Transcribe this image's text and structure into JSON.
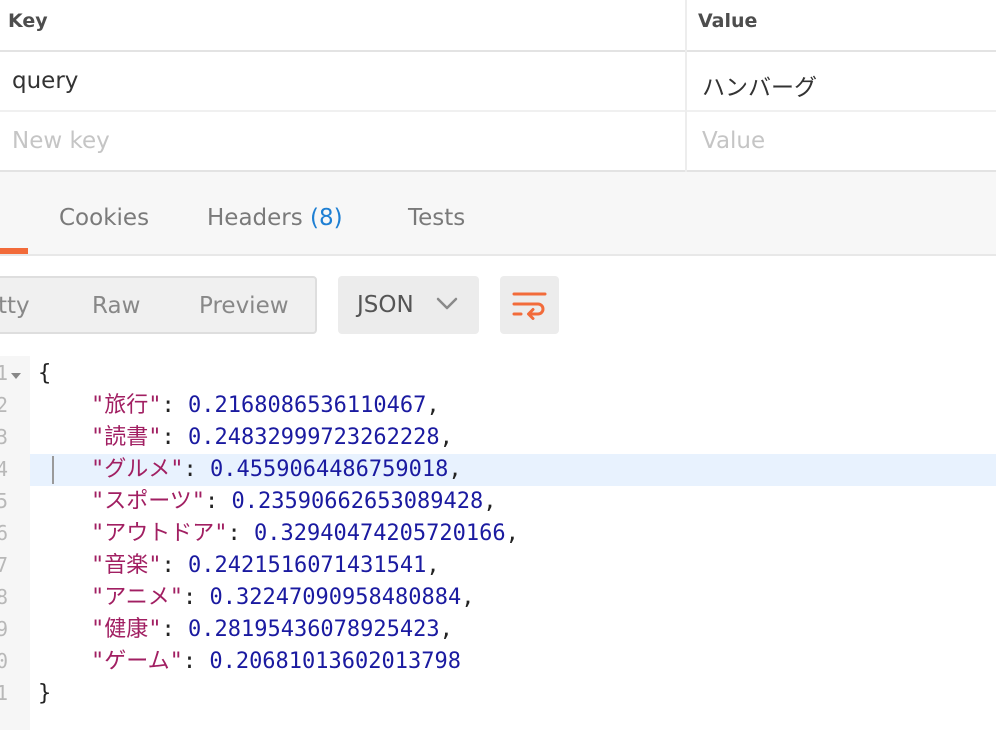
{
  "params": {
    "header": {
      "key": "Key",
      "value": "Value"
    },
    "rows": [
      {
        "key": "query",
        "value": "ハンバーグ"
      }
    ],
    "new_row": {
      "key_placeholder": "New key",
      "value_placeholder": "Value"
    }
  },
  "response_tabs": {
    "tabs": [
      {
        "label": "Cookies"
      },
      {
        "label": "Headers",
        "count": "(8)"
      },
      {
        "label": "Tests"
      }
    ]
  },
  "toolbar": {
    "view_modes": [
      "tty",
      "Raw",
      "Preview"
    ],
    "format": "JSON"
  },
  "colors": {
    "accent": "#f26b3a",
    "link_blue": "#1e7fd3",
    "json_key": "#a11f62",
    "json_number": "#1a1aa0",
    "highlight_line": "#e8f2fe"
  },
  "code": {
    "line_numbers": [
      "1",
      "2",
      "3",
      "4",
      "5",
      "6",
      "7",
      "8",
      "9",
      "0",
      "0",
      "1"
    ],
    "open_brace": "{",
    "close_brace": "}",
    "entries": [
      {
        "key": "\"旅行\"",
        "value": "0.2168086536110467",
        "comma": ","
      },
      {
        "key": "\"読書\"",
        "value": "0.24832999723262228",
        "comma": ","
      },
      {
        "key": "\"グルメ\"",
        "value": "0.4559064486759018",
        "comma": ","
      },
      {
        "key": "\"スポーツ\"",
        "value": "0.23590662653089428",
        "comma": ","
      },
      {
        "key": "\"アウトドア\"",
        "value": "0.32940474205720166",
        "comma": ","
      },
      {
        "key": "\"音楽\"",
        "value": "0.2421516071431541",
        "comma": ","
      },
      {
        "key": "\"アニメ\"",
        "value": "0.32247090958480884",
        "comma": ","
      },
      {
        "key": "\"健康\"",
        "value": "0.28195436078925423",
        "comma": ","
      },
      {
        "key": "\"ゲーム\"",
        "value": "0.20681013602013798",
        "comma": ""
      }
    ]
  }
}
